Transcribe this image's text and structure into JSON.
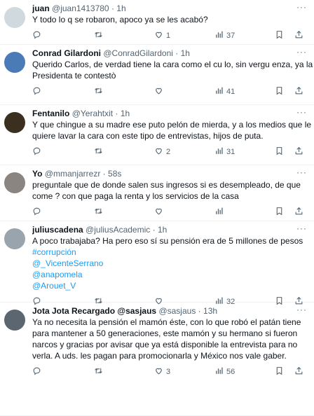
{
  "tweets": [
    {
      "name": "juan",
      "handle": "@juan1413780",
      "dot": "·",
      "time": "1h",
      "lines": [
        "Y todo lo q se robaron, apoco ya se les acabó?"
      ],
      "links": [],
      "reply_count": "",
      "retweet_count": "",
      "like_count": "1",
      "view_count": "37",
      "avatar_color": "#cfd9de"
    },
    {
      "name": "Conrad Gilardoni",
      "handle": "@ConradGilardoni",
      "dot": "·",
      "time": "1h",
      "lines": [
        "Querido Carlos, de verdad tiene la cara como el cu lo, sin vergu  enza, ya la",
        "Presidenta te contestò"
      ],
      "links": [],
      "reply_count": "",
      "retweet_count": "",
      "like_count": "",
      "view_count": "41",
      "avatar_color": "#4a7bb7"
    },
    {
      "name": "Fentanilo",
      "handle": "@Yerahtxit",
      "dot": "·",
      "time": "1h",
      "lines": [
        "Y que chingue a su madre ese puto pelón de mierda, y a los medios que le",
        "quiere lavar la cara con este tipo de entrevistas, hijos de puta."
      ],
      "links": [],
      "reply_count": "",
      "retweet_count": "",
      "like_count": "2",
      "view_count": "31",
      "avatar_color": "#3b3020"
    },
    {
      "name": "Yo",
      "handle": "@mmanjarrezr",
      "dot": "·",
      "time": "58s",
      "lines": [
        "preguntale que de donde salen sus ingresos si es desempleado, de que",
        "come ? con que paga la renta y los servicios de la casa"
      ],
      "links": [],
      "reply_count": "",
      "retweet_count": "",
      "like_count": "",
      "view_count": "",
      "avatar_color": "#8a8580"
    },
    {
      "name": "juliuscadena",
      "handle": "@juliusAcademic",
      "dot": "·",
      "time": "1h",
      "lines": [
        "A poco trabajaba? Ha pero eso sí su pensión era de 5 millones de pesos"
      ],
      "links": [
        "#corrupción",
        "@_VicenteSerrano",
        "@anapomela",
        "@Arouet_V"
      ],
      "reply_count": "",
      "retweet_count": "",
      "like_count": "",
      "view_count": "32",
      "avatar_color": "#9aa4ad"
    },
    {
      "name": "Jota Jota Recargado @sasjaus",
      "handle": "@sasjaus",
      "dot": "·",
      "time": "13h",
      "lines": [
        "Ya no necesita la pensión el mamón éste, con lo que robó el patán tiene",
        "para mantener a 50 generaciones, este mamón y su hermano si fueron",
        "narcos y gracias por avisar que ya está disponible la entrevista para no",
        "verla. A uds. les pagan para promocionarla y México nos vale gaber."
      ],
      "links": [],
      "reply_count": "",
      "retweet_count": "",
      "like_count": "3",
      "view_count": "56",
      "avatar_color": "#5c6670"
    }
  ],
  "more_glyph": "···",
  "icons": {
    "reply": "reply-icon",
    "retweet": "retweet-icon",
    "like": "like-icon",
    "views": "views-icon",
    "bookmark": "bookmark-icon",
    "share": "share-icon"
  },
  "colors": {
    "text": "#0f1419",
    "muted": "#536471",
    "link": "#1d9bf0",
    "divider": "#eff3f4"
  }
}
